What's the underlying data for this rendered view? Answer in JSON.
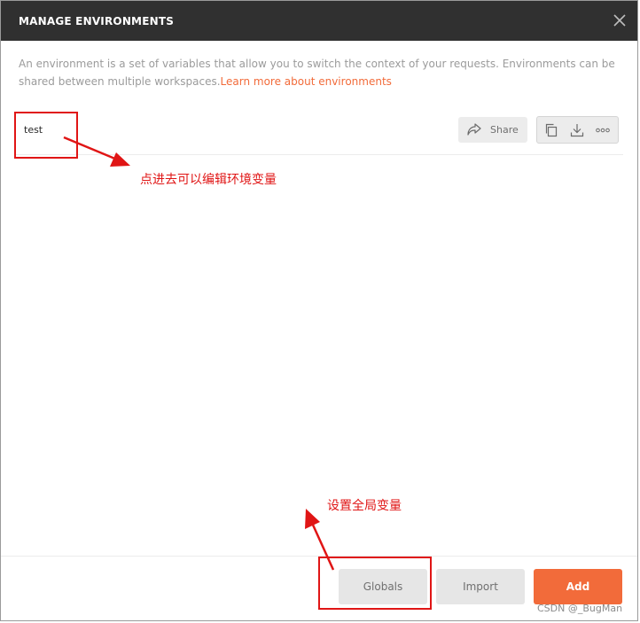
{
  "dialog": {
    "title": "MANAGE ENVIRONMENTS",
    "description": "An environment is a set of variables that allow you to switch the context of your requests. Environments can be shared between multiple workspaces.",
    "learn_more_link": "Learn more about environments"
  },
  "environments": [
    {
      "name": "test",
      "share_label": "Share"
    }
  ],
  "icons": {
    "close": "close-icon",
    "share": "share-arrow-icon",
    "duplicate": "duplicate-icon",
    "download": "download-icon",
    "more": "more-options-icon"
  },
  "footer": {
    "globals_label": "Globals",
    "import_label": "Import",
    "add_label": "Add"
  },
  "annotations": {
    "edit_hint": "点进去可以编辑环境变量",
    "globals_hint": "设置全局变量"
  },
  "watermark": "CSDN @_BugMan",
  "colors": {
    "header_bg": "#303030",
    "accent": "#f26b3a",
    "annotation_red": "#e01515"
  }
}
